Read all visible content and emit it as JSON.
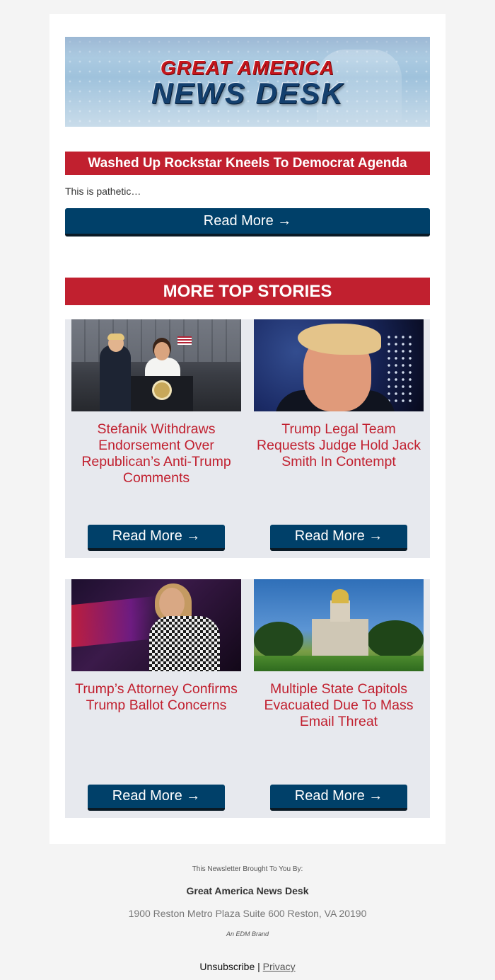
{
  "brand": {
    "line1": "GREAT AMERICA",
    "line2": "NEWS DESK"
  },
  "featured": {
    "headline": "Washed Up Rockstar Kneels To Democrat Agenda",
    "teaser": "This is pathetic…",
    "button": "Read More →"
  },
  "section": {
    "title": "MORE TOP STORIES"
  },
  "stories": [
    {
      "title": "Stefanik Withdraws Endorsement Over Republican’s Anti-Trump Comments",
      "button": "Read More →"
    },
    {
      "title": "Trump Legal Team Requests Judge Hold Jack Smith In Contempt",
      "button": "Read More →"
    },
    {
      "title": "Trump’s Attorney Confirms Trump Ballot Concerns",
      "button": "Read More →"
    },
    {
      "title": "Multiple State Capitols Evacuated Due To Mass Email Threat",
      "button": "Read More →"
    }
  ],
  "footer": {
    "brought_by": "This Newsletter Brought To You By:",
    "name": "Great America News Desk",
    "address": "1900 Reston Metro Plaza Suite 600 Reston, VA 20190",
    "brand_note": "An EDM Brand",
    "unsubscribe": "Unsubscribe",
    "separator": " | ",
    "privacy": "Privacy"
  },
  "colors": {
    "accent_red": "#c1202f",
    "button_blue": "#004069",
    "card_gray": "#e7e9ee"
  }
}
